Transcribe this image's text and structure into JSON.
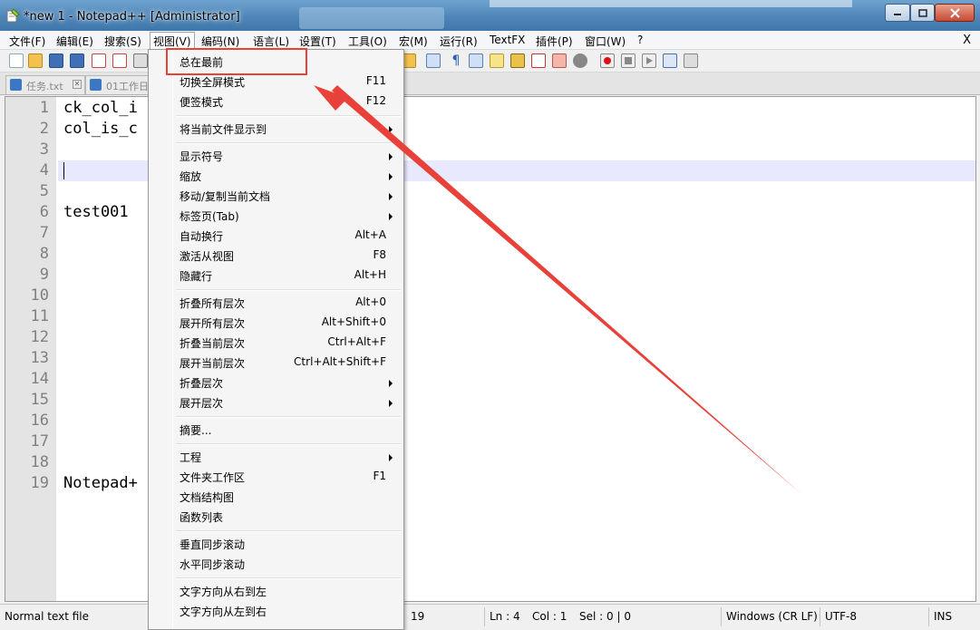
{
  "window": {
    "title": "*new 1 - Notepad++ [Administrator]",
    "controls": [
      "minimize",
      "maximize",
      "close"
    ]
  },
  "menubar": {
    "items": [
      {
        "label": "文件(F)"
      },
      {
        "label": "编辑(E)"
      },
      {
        "label": "搜索(S)"
      },
      {
        "label": "视图(V)",
        "active": true
      },
      {
        "label": "编码(N)"
      },
      {
        "label": "语言(L)"
      },
      {
        "label": "设置(T)"
      },
      {
        "label": "工具(O)"
      },
      {
        "label": "宏(M)"
      },
      {
        "label": "运行(R)"
      },
      {
        "label": "TextFX"
      },
      {
        "label": "插件(P)"
      },
      {
        "label": "窗口(W)"
      },
      {
        "label": "?"
      }
    ],
    "close_label": "X"
  },
  "tabs": [
    {
      "label": "任务.txt"
    },
    {
      "label": "01工作日"
    }
  ],
  "editor": {
    "line_numbers": [
      "1",
      "2",
      "3",
      "4",
      "5",
      "6",
      "7",
      "8",
      "9",
      "10",
      "11",
      "12",
      "13",
      "14",
      "15",
      "16",
      "17",
      "18",
      "19"
    ],
    "lines": {
      "l1": "ck_col_i",
      "l2": "col_is_c",
      "l6": "test001",
      "l19": "Notepad+"
    },
    "current_line": 4
  },
  "dropdown": {
    "items": [
      {
        "label": "总在最前",
        "shortcut": "",
        "submenu": false
      },
      {
        "label": "切换全屏模式",
        "shortcut": "F11",
        "submenu": false
      },
      {
        "label": "便签模式",
        "shortcut": "F12",
        "submenu": false
      },
      {
        "label": "将当前文件显示到",
        "shortcut": "",
        "submenu": true
      },
      {
        "label": "显示符号",
        "shortcut": "",
        "submenu": true
      },
      {
        "label": "缩放",
        "shortcut": "",
        "submenu": true
      },
      {
        "label": "移动/复制当前文档",
        "shortcut": "",
        "submenu": true
      },
      {
        "label": "标签页(Tab)",
        "shortcut": "",
        "submenu": true
      },
      {
        "label": "自动换行",
        "shortcut": "Alt+A",
        "submenu": false
      },
      {
        "label": "激活从视图",
        "shortcut": "F8",
        "submenu": false
      },
      {
        "label": "隐藏行",
        "shortcut": "Alt+H",
        "submenu": false
      },
      {
        "label": "折叠所有层次",
        "shortcut": "Alt+0",
        "submenu": false
      },
      {
        "label": "展开所有层次",
        "shortcut": "Alt+Shift+0",
        "submenu": false
      },
      {
        "label": "折叠当前层次",
        "shortcut": "Ctrl+Alt+F",
        "submenu": false
      },
      {
        "label": "展开当前层次",
        "shortcut": "Ctrl+Alt+Shift+F",
        "submenu": false
      },
      {
        "label": "折叠层次",
        "shortcut": "",
        "submenu": true
      },
      {
        "label": "展开层次",
        "shortcut": "",
        "submenu": true
      },
      {
        "label": "摘要...",
        "shortcut": "",
        "submenu": false
      },
      {
        "label": "工程",
        "shortcut": "",
        "submenu": true
      },
      {
        "label": "文件夹工作区",
        "shortcut": "F1",
        "submenu": false
      },
      {
        "label": "文档结构图",
        "shortcut": "",
        "submenu": false
      },
      {
        "label": "函数列表",
        "shortcut": "",
        "submenu": false
      },
      {
        "label": "垂直同步滚动",
        "shortcut": "",
        "submenu": false
      },
      {
        "label": "水平同步滚动",
        "shortcut": "",
        "submenu": false
      },
      {
        "label": "文字方向从右到左",
        "shortcut": "",
        "submenu": false
      },
      {
        "label": "文字方向从左到右",
        "shortcut": "",
        "submenu": false
      }
    ]
  },
  "statusbar": {
    "file_type": "Normal text file",
    "lines": "19",
    "ln": "Ln : 4",
    "col": "Col : 1",
    "sel": "Sel : 0 | 0",
    "eol": "Windows (CR LF)",
    "encoding": "UTF-8",
    "mode": "INS"
  },
  "annotation": {
    "color": "#e8413a",
    "highlighted_item": "总在最前"
  }
}
